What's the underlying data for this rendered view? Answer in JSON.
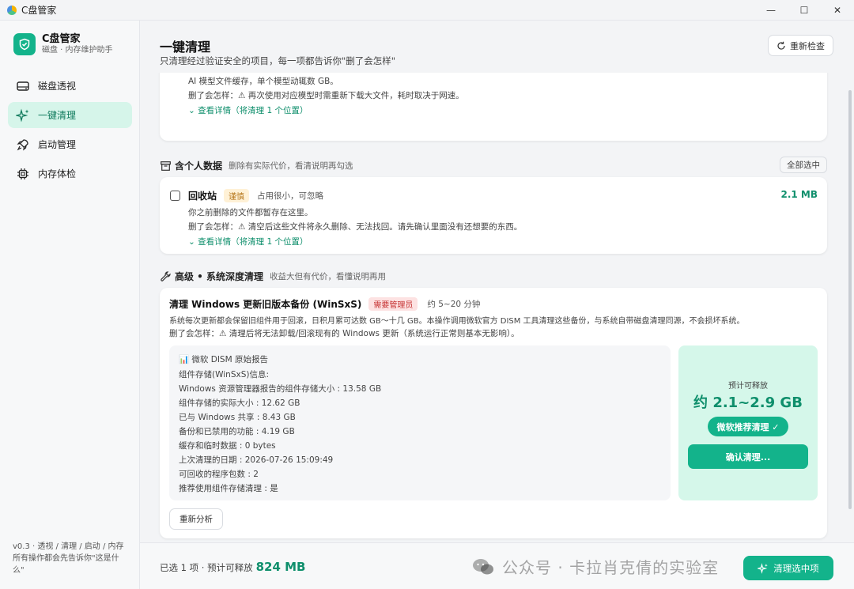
{
  "window": {
    "title": "C盘管家",
    "minimize": "—",
    "maximize": "☐",
    "close": "✕"
  },
  "sidebar": {
    "brand_name": "C盘管家",
    "brand_sub": "磁盘 · 内存维护助手",
    "items": [
      {
        "label": "磁盘透视",
        "icon": "disk-icon"
      },
      {
        "label": "一键清理",
        "icon": "sparkle-icon",
        "active": true
      },
      {
        "label": "启动管理",
        "icon": "rocket-icon"
      },
      {
        "label": "内存体检",
        "icon": "chip-icon"
      }
    ],
    "footer_line1": "v0.3 · 透视 / 清理 / 启动 / 内存",
    "footer_line2": "所有操作都会先告诉你\"这是什",
    "footer_line3": "么\""
  },
  "header": {
    "title": "一键清理",
    "subtitle": "只清理经过验证安全的项目，每一项都告诉你\"删了会怎样\"",
    "recheck": "重新检查"
  },
  "top_card": {
    "desc": "AI 模型文件缓存，单个模型动辄数 GB。",
    "effect": "删了会怎样：⚠ 再次使用对应模型时需重新下载大文件，耗时取决于网速。",
    "detail": "⌄ 查看详情（将清理 1 个位置）"
  },
  "personal_section": {
    "title": "含个人数据",
    "desc": "删除有实际代价，看清说明再勾选",
    "select_all": "全部选中",
    "item": {
      "name": "回收站",
      "tag": "谨慎",
      "note": "占用很小，可忽略",
      "size": "2.1 MB",
      "desc": "你之前删除的文件都暂存在这里。",
      "effect": "删了会怎样：⚠ 清空后这些文件将永久删除、无法找回。请先确认里面没有还想要的东西。",
      "detail": "⌄ 查看详情（将清理 1 个位置）"
    }
  },
  "advanced_section": {
    "title": "高级 • 系统深度清理",
    "desc": "收益大但有代价，看懂说明再用",
    "item": {
      "name": "清理 Windows 更新旧版本备份 (WinSxS)",
      "tag": "需要管理员",
      "time": "约 5~20 分钟",
      "desc": "系统每次更新都会保留旧组件用于回滚，日积月累可达数 GB～十几 GB。本操作调用微软官方 DISM 工具清理这些备份，与系统自带磁盘清理同源，不会损坏系统。",
      "effect": "删了会怎样：⚠ 清理后将无法卸载/回滚现有的 Windows 更新（系统运行正常则基本无影响）。",
      "report_title": "📊 微软 DISM 原始报告",
      "report_lines": [
        "组件存储(WinSxS)信息:",
        "Windows 资源管理器报告的组件存储大小 : 13.58 GB",
        "组件存储的实际大小 : 12.62 GB",
        "已与 Windows 共享 : 8.43 GB",
        "备份和已禁用的功能 : 4.19 GB",
        "缓存和临时数据 : 0 bytes",
        "上次清理的日期 : 2026-07-26 15:09:49",
        "可回收的程序包数 : 2",
        "推荐使用组件存储清理 : 是"
      ],
      "release_label": "预计可释放",
      "release_value": "约 2.1~2.9 GB",
      "recommend_badge": "微软推荐清理 ✓",
      "confirm_button": "确认清理...",
      "reanalyze_button": "重新分析"
    }
  },
  "footer": {
    "summary": "已选 1 项 · 预计可释放",
    "size": "824 MB",
    "watermark": "公众号 · 卡拉肖克倩的实验室",
    "clean_button": "清理选中项"
  },
  "colors": {
    "accent": "#13b38b",
    "accent_dark": "#0f8f6c",
    "active_bg": "#d6f5ea"
  }
}
